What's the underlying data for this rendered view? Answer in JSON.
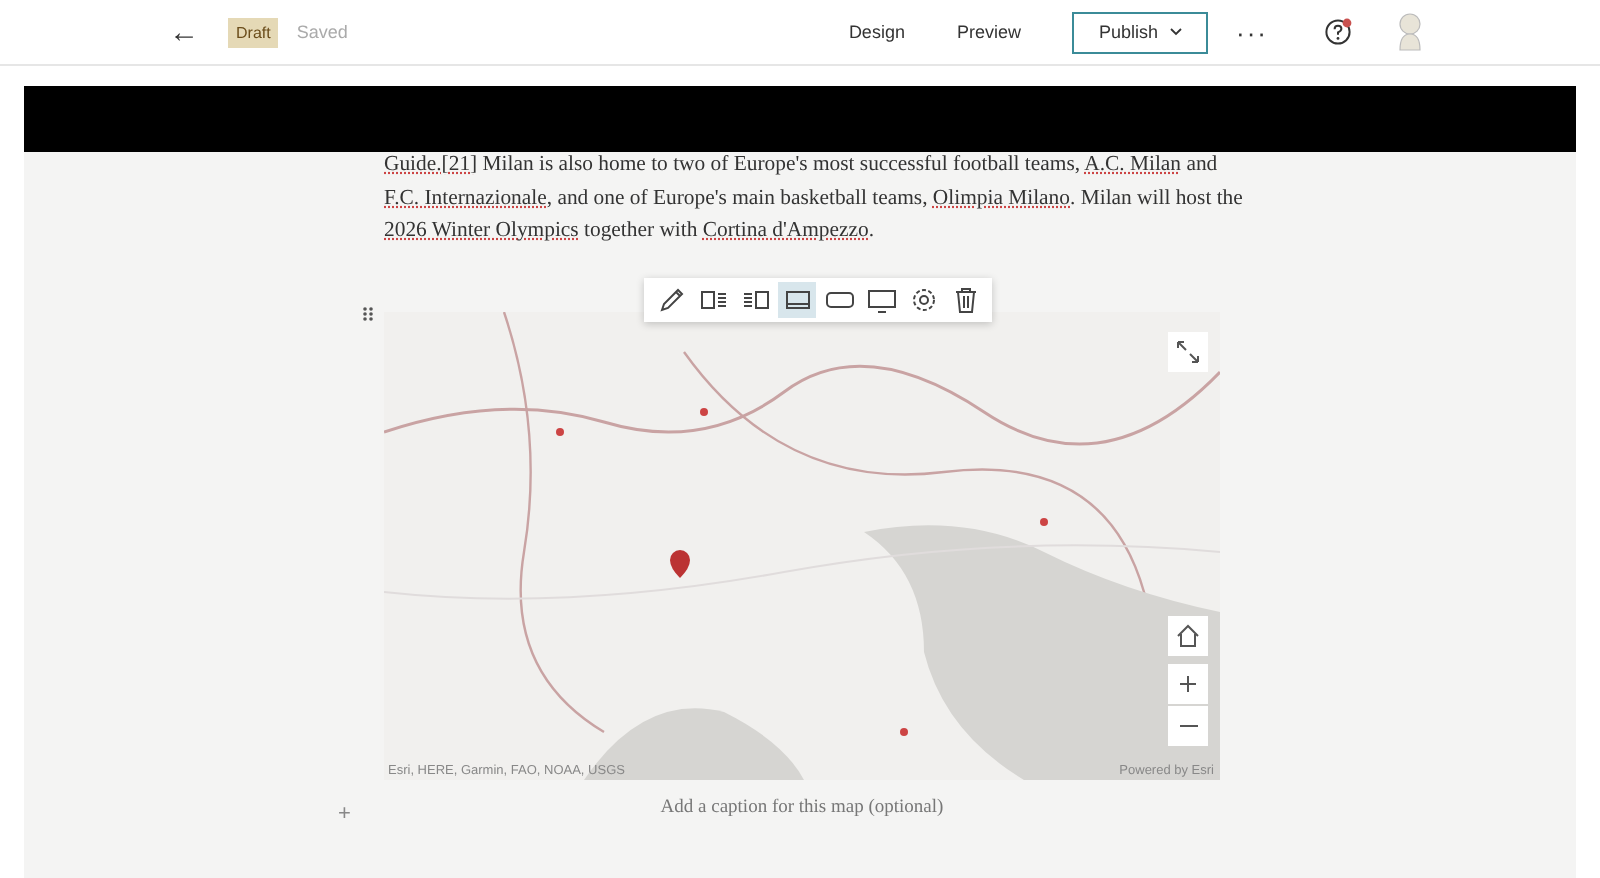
{
  "header": {
    "back": "←",
    "status_badge": "Draft",
    "save_state": "Saved",
    "nav": [
      {
        "label": "Design",
        "kind": "link"
      },
      {
        "label": "Preview",
        "kind": "link"
      },
      {
        "label": "Publish",
        "kind": "primary"
      }
    ],
    "more": "···",
    "help_notification": true
  },
  "paragraph": [
    {
      "kind": "link",
      "text": "Guide.[21]"
    },
    {
      "kind": "plain",
      "text": " Milan is also home to two of Europe's most successful football teams, "
    },
    {
      "kind": "link",
      "text": "A.C. Milan"
    },
    {
      "kind": "plain",
      "text": " and "
    },
    {
      "kind": "link",
      "text": "F.C. Internazionale"
    },
    {
      "kind": "plain",
      "text": ", and one of Europe's main basketball teams, "
    },
    {
      "kind": "link",
      "text": "Olimpia Milano"
    },
    {
      "kind": "plain",
      "text": ". Milan will host the "
    },
    {
      "kind": "link",
      "text": "2026 Winter Olympics"
    },
    {
      "kind": "plain",
      "text": " together with "
    },
    {
      "kind": "link",
      "text": "Cortina d'Ampezzo"
    },
    {
      "kind": "plain",
      "text": "."
    }
  ],
  "block_toolbar": [
    {
      "kind": "edit",
      "selected": false
    },
    {
      "kind": "float-left",
      "selected": false
    },
    {
      "kind": "float-right",
      "selected": false
    },
    {
      "kind": "standard",
      "selected": true
    },
    {
      "kind": "wide",
      "selected": false
    },
    {
      "kind": "full",
      "selected": false
    },
    {
      "kind": "settings",
      "selected": false
    },
    {
      "kind": "delete",
      "selected": false
    }
  ],
  "map": {
    "kind": "picture",
    "attribution": "Esri, HERE, Garmin, FAO, NOAA, USGS",
    "powered_by": "Powered by Esri"
  },
  "caption": {
    "placeholder": "Add a caption for this map (optional)"
  },
  "add_block": "+"
}
